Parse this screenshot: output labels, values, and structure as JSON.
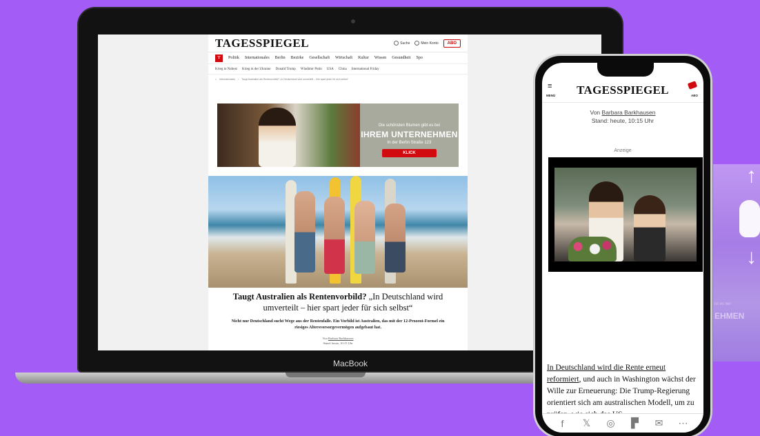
{
  "laptop": {
    "brand_label": "MacBook",
    "site": {
      "logo": "TAGESSPIEGEL",
      "header": {
        "search_label": "Suche",
        "account_label": "Mein Konto",
        "abo_label": "ABO"
      },
      "section_badge": "T",
      "nav_primary": [
        "Politik",
        "Internationales",
        "Berlin",
        "Bezirke",
        "Gesellschaft",
        "Wirtschaft",
        "Kultur",
        "Wissen",
        "Gesundheit",
        "Spo"
      ],
      "nav_secondary": [
        "Krieg in Nahost",
        "Krieg in der Ukraine",
        "Donald Trump",
        "Wladimir Putin",
        "USA",
        "China",
        "International Friday"
      ],
      "breadcrumb": [
        "Internationales",
        "Taugt Australien als Rentenvorbild? „In Deutschland wird umverteilt – hier spart jeder für sich selbst“"
      ],
      "ad": {
        "line1": "Die schönsten Blumen gibt es bei",
        "line2": "IHREM UNTERNEHMEN",
        "line3": "In der Berlin Straße 123",
        "button": "KLICK"
      },
      "article": {
        "headline_bold": "Taugt Australien als Rentenvorbild?",
        "headline_rest": " „In Deutschland wird umverteilt – hier spart jeder für sich selbst“",
        "lede": "Nicht nur Deutschland sucht Wege aus der Rentenfalle. Ein Vorbild ist Australien, das mit der 12-Prozent-Formel ein riesiges Altersvorsorgevermögen aufgebaut hat.",
        "byline_prefix": "Von",
        "author": "Barbara Barkhausen",
        "stand": "Stand: heute, 10:15 Uhr"
      }
    }
  },
  "phone": {
    "menu_label": "MENÜ",
    "logo": "TAGESSPIEGEL",
    "abo_label": "ABO",
    "byline_prefix": "Von",
    "author": "Barbara Barkhausen",
    "stand": "Stand: heute, 10:15 Uhr",
    "ad_label": "Anzeige",
    "body_link": "In Deutschland wird die Rente erneut reformiert",
    "body_text": ", und auch in Washington wächst der Wille zur Erneuerung: Die Trump-Regierung orientiert sich am australischen Modell, um zu prüfen, wie sich das US-",
    "share_icons": [
      "facebook-icon",
      "x-icon",
      "whatsapp-icon",
      "flipboard-icon",
      "mail-icon",
      "more-icon"
    ]
  },
  "side_overlay": {
    "small_text": "ist es bei",
    "big_text": "EHMEN"
  }
}
